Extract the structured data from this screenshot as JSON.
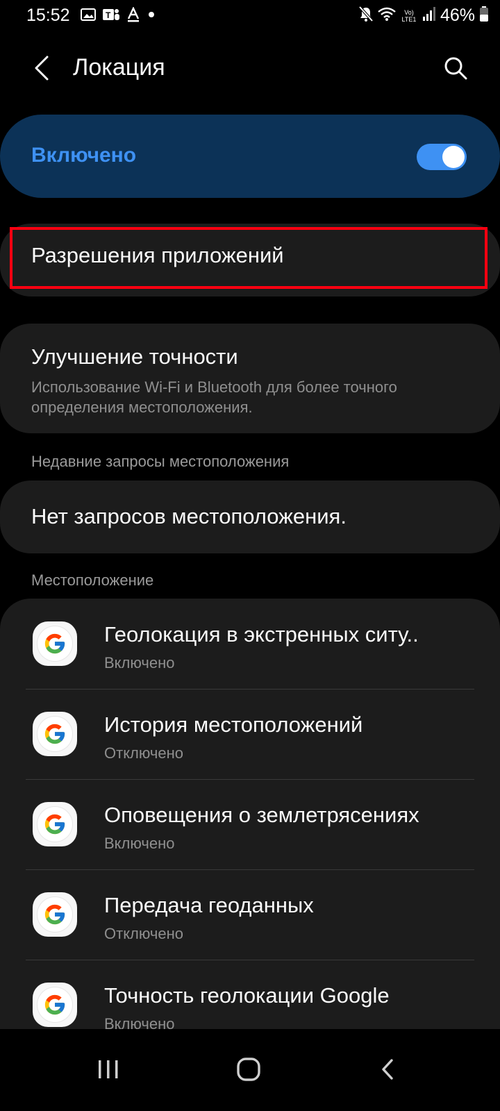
{
  "status_bar": {
    "time": "15:52",
    "battery": "46%",
    "network_label": "Vo) LTE1",
    "left_icons": [
      "gallery-icon",
      "teams-icon",
      "font-icon",
      "dot-icon"
    ],
    "right_icons": [
      "mute-icon",
      "wifi-icon",
      "signal-icon",
      "battery-icon"
    ]
  },
  "header": {
    "title": "Локация",
    "back_icon": "back-arrow-icon",
    "search_icon": "search-icon"
  },
  "master_switch": {
    "label": "Включено",
    "state": "on",
    "accent_color": "#3e91f3",
    "background_color": "#0c3257"
  },
  "permissions": {
    "label": "Разрешения приложений",
    "highlight_color": "#ff0011"
  },
  "accuracy": {
    "title": "Улучшение точности",
    "subtitle": "Использование Wi-Fi и Bluetooth для более точного определения местоположения."
  },
  "recent": {
    "header": "Недавние запросы местоположения",
    "empty_text": "Нет запросов местоположения."
  },
  "services": {
    "header": "Местоположение",
    "items": [
      {
        "title": "Геолокация в экстренных ситу..",
        "status": "Включено",
        "icon": "google-icon"
      },
      {
        "title": "История местоположений",
        "status": "Отключено",
        "icon": "google-icon"
      },
      {
        "title": "Оповещения о землетрясениях",
        "status": "Включено",
        "icon": "google-icon"
      },
      {
        "title": "Передача геоданных",
        "status": "Отключено",
        "icon": "google-icon"
      },
      {
        "title": "Точность геолокации Google",
        "status": "Включено",
        "icon": "google-icon"
      }
    ]
  },
  "nav_bar": {
    "recents_icon": "recents-icon",
    "home_icon": "home-icon",
    "back_icon": "back-icon"
  }
}
